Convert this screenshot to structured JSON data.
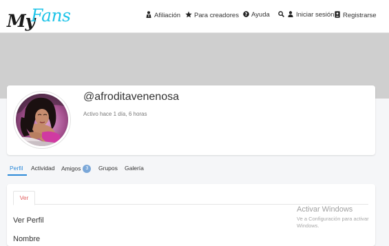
{
  "brand": {
    "logo_my": "My",
    "logo_fans": "Fans"
  },
  "nav": [
    {
      "label": "Afiliación",
      "icon": "person-tie-icon"
    },
    {
      "label": "Para creadores",
      "icon": "star-icon"
    },
    {
      "label": "Ayuda",
      "icon": "question-circle-icon"
    },
    {
      "label": "",
      "icon": "search-icon"
    },
    {
      "label": "Iniciar sesión",
      "icon": "user-icon"
    },
    {
      "label": "Registrarse",
      "icon": "id-card-icon"
    }
  ],
  "profile": {
    "username": "@afroditavenenosa",
    "last_active": "Activo hace 1 día, 6 horas"
  },
  "tabs": [
    {
      "label": "Perfil",
      "active": true
    },
    {
      "label": "Actividad"
    },
    {
      "label": "Amigos",
      "badge": "3"
    },
    {
      "label": "Grupos"
    },
    {
      "label": "Galería"
    }
  ],
  "content": {
    "inner_tab": "Ver",
    "section_title": "Ver Perfil",
    "field_label": "Nombre"
  },
  "watermark": {
    "title": "Activar Windows",
    "line1": "Ve a Configuración para activar",
    "line2": "Windows."
  },
  "colors": {
    "accent": "#2a88d8",
    "logo_fans": "#1ec4e8",
    "banner": "#cfcfcf",
    "inner_tab": "#e05c5c"
  }
}
